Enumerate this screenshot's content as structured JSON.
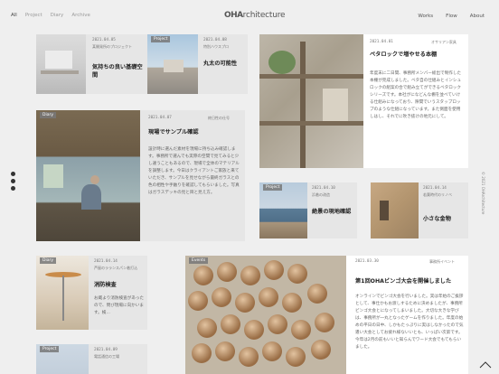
{
  "filters": [
    "All",
    "Project",
    "Diary",
    "Archive"
  ],
  "logo": {
    "strong": "OHA",
    "rest": "rchitecture"
  },
  "nav": [
    "Works",
    "Flow",
    "About"
  ],
  "copyright": "© 2021 OHArchitecture",
  "cards": {
    "c1": {
      "date": "2021.04.05",
      "tag": "某開発所のプロジェクト",
      "title": "気持ちの良い基礎空間"
    },
    "c2": {
      "label": "Project",
      "date": "2021.04.08",
      "tag": "特別ハウスプロ",
      "title": "丸太の可能性"
    },
    "c3": {
      "date": "2021.04.01",
      "tag": "オサリアン家具",
      "title": "ベタロックで増やせる本棚",
      "body": "年度末に二日間、事務所メンバー総出で制作した本棚が完成しました。ベタ自の仕組みとインシュロックの組案の合で組み立てができるベタロックシリーズです。本社がになどんな棚を並べていける仕組みになっており、隙間でいうスタップロップのような仕組になっています。また側面を使用しはし、それでに吹き抜けの地元にして。"
    },
    "c4": {
      "label": "Diary",
      "date": "2021.04.07",
      "tag": "終日性の仕号",
      "title": "現場でサンプル確認",
      "body": "設計時に選んだ素材を現場に持ち込み確認します。事務所で選んでも実際の空間で見てみると少し違うこともあるので、現場で全体のマテリアルを調整します。今日はクライアントご家族と来ていただき、サンプルを見せながら最終ガラスとの色の相性や手触りを確認してもらいました。写真はガラスデッキの見と目と見え方。"
    },
    "c5": {
      "label": "Project",
      "date": "2021.04.10",
      "tag": "浜着の改造",
      "title": "絶景の現地確認"
    },
    "c6": {
      "date": "2021.04.14",
      "tag": "若葉時代のリノベ",
      "title": "小さな金物"
    },
    "c7": {
      "label": "Diary",
      "date": "2021.04.14",
      "tag": "芦屋のラランスパン着打込",
      "title": "消防検査",
      "body": "お蔵より消防検査があったので、問び現場に向かいます。検…"
    },
    "c8": {
      "label": "Events",
      "date": "2021.03.30",
      "tag": "事務所イベント",
      "title": "第1回OHAビンゴ大会を開催しました",
      "body": "オンラインでビンゴ大会を行いました。実は年始のご挨拶として、事仕かもお渡しするために決めましたが、事務所ビンゴ大会とになってしまいました。大切な大きな学びは、事務所が一丸となったゲームを作りました。年度の始めの平日の日中、しかもたっぷりに実はしなかったので気遣い大会としてお疲れ様ないいとも、いっぱい次第です。今年は2月の前もいいと知らんでワード大会でもてもらいました。"
    },
    "c9": {
      "label": "Project",
      "date": "2021.04.09",
      "tag": "電話通信の工場"
    }
  },
  "icons": {
    "social": [
      "instagram-icon",
      "facebook-icon",
      "twitter-icon"
    ],
    "scroll": "scroll-top-icon"
  }
}
